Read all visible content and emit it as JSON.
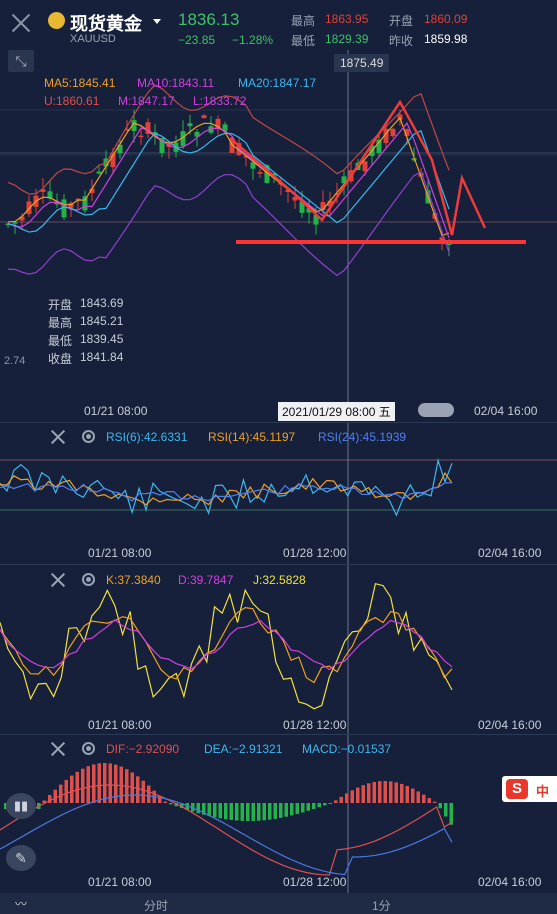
{
  "header": {
    "instrument_name": "现货黄金",
    "symbol": "XAUUSD",
    "last_price": "1836.13",
    "change": "−23.85",
    "change_pct": "−1.28%",
    "high_label": "最高",
    "high": "1863.95",
    "open_label": "开盘",
    "open": "1860.09",
    "low_label": "最低",
    "low": "1829.39",
    "prev_close_label": "昨收",
    "prev_close": "1859.98"
  },
  "main_chart": {
    "ma5": "MA5:1845.41",
    "ma10": "MA10:1843.11",
    "ma20": "MA20:1847.17",
    "boll_u": "U:1860.61",
    "boll_m": "M:1847.17",
    "boll_l": "L:1833.72",
    "peak_label": "1875.49",
    "ohlc": {
      "open_label": "开盘",
      "open": "1843.69",
      "high_label": "最高",
      "high": "1845.21",
      "low_label": "最低",
      "low": "1839.45",
      "close_label": "收盘",
      "close": "1841.84"
    },
    "left_price": "2.74",
    "x_ticks": [
      "01/21 08:00",
      "2021/01/29 08:00 五",
      "02/04 16:00"
    ]
  },
  "rsi_panel": {
    "rsi6": "RSI(6):42.6331",
    "rsi14": "RSI(14):45.1197",
    "rsi24": "RSI(24):45.1939",
    "x_ticks": [
      "01/21 08:00",
      "01/28 12:00",
      "02/04 16:00"
    ]
  },
  "kdj_panel": {
    "k": "K:37.3840",
    "d": "D:39.7847",
    "j": "J:32.5828",
    "x_ticks": [
      "01/21 08:00",
      "01/28 12:00",
      "02/04 16:00"
    ]
  },
  "macd_panel": {
    "dif": "DIF:−2.92090",
    "dea": "DEA:−2.91321",
    "macd": "MACD:−0.01537",
    "x_ticks": [
      "01/21 08:00",
      "01/28 12:00",
      "02/04 16:00"
    ]
  },
  "tabs": [
    "分时",
    "1分"
  ],
  "ime_badge": "中",
  "colors": {
    "up": "#e0413a",
    "down": "#24b34a",
    "ma5": "#f0a020",
    "ma10": "#d040e0",
    "ma20": "#3aa0f0",
    "boll": "#e05050",
    "bg": "#16203a"
  }
}
